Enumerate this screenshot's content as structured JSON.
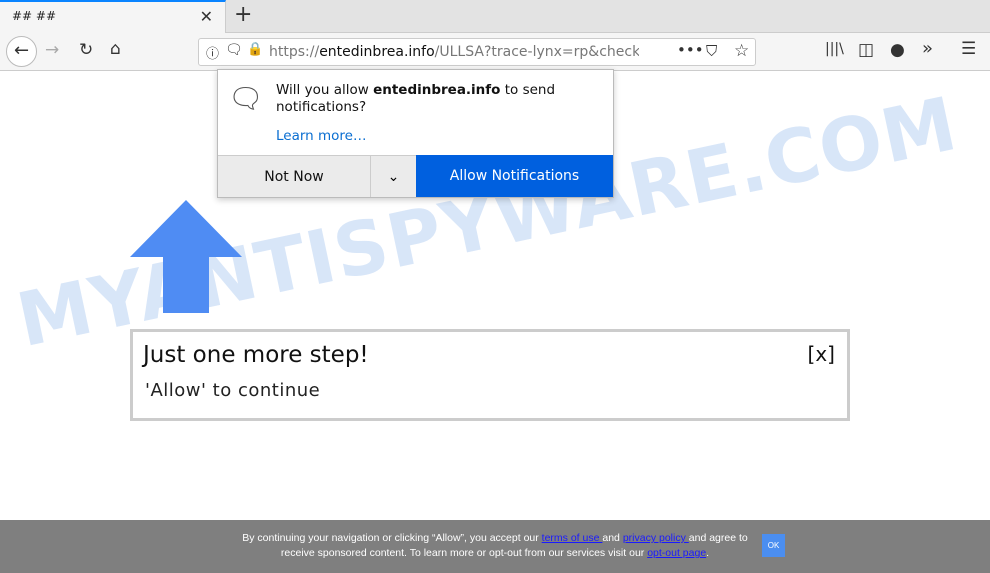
{
  "browser": {
    "tab_title": "## ##",
    "url_host": "entedinbrea.info",
    "url_prefix": "https://",
    "url_path": "/ULLSA?trace-lynx=rp&checklyn"
  },
  "popup": {
    "msg_pre": "Will you allow ",
    "msg_host": "entedinbrea.info",
    "msg_post": " to send notifications?",
    "learn_more": "Learn more…",
    "not_now": "Not Now",
    "allow": "Allow Notifications"
  },
  "page": {
    "title": "Just one more step!",
    "subtitle": "'Allow' to continue",
    "close": "[x]",
    "watermark": "MYANTISPYWARE.COM",
    "arrow_color": "#4f8cf3"
  },
  "footer": {
    "t1": "By continuing your navigation or clicking “Allow”, you accept our ",
    "terms": "terms of use ",
    "t2": "and ",
    "privacy": "privacy policy ",
    "t3": "and agree to",
    "t4": "receive sponsored content. To learn more or opt-out from our services visit our ",
    "optout": "opt-out page",
    "t5": ".",
    "ok": "OK"
  }
}
